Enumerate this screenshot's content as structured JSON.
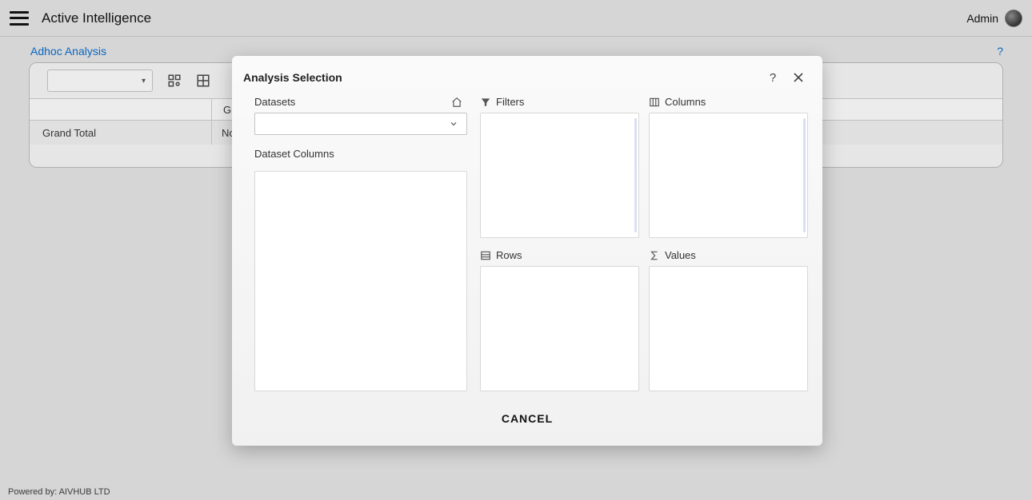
{
  "header": {
    "app_title": "Active Intelligence",
    "username": "Admin"
  },
  "breadcrumb": "Adhoc Analysis",
  "grid": {
    "header_col2": "Gr",
    "row_label": "Grand Total",
    "row_value": "No"
  },
  "modal": {
    "title": "Analysis Selection",
    "datasets_label": "Datasets",
    "dataset_columns_label": "Dataset Columns",
    "filters_label": "Filters",
    "columns_label": "Columns",
    "rows_label": "Rows",
    "values_label": "Values",
    "cancel_label": "CANCEL"
  },
  "footer": {
    "powered_by": "Powered by: AIVHUB LTD"
  }
}
